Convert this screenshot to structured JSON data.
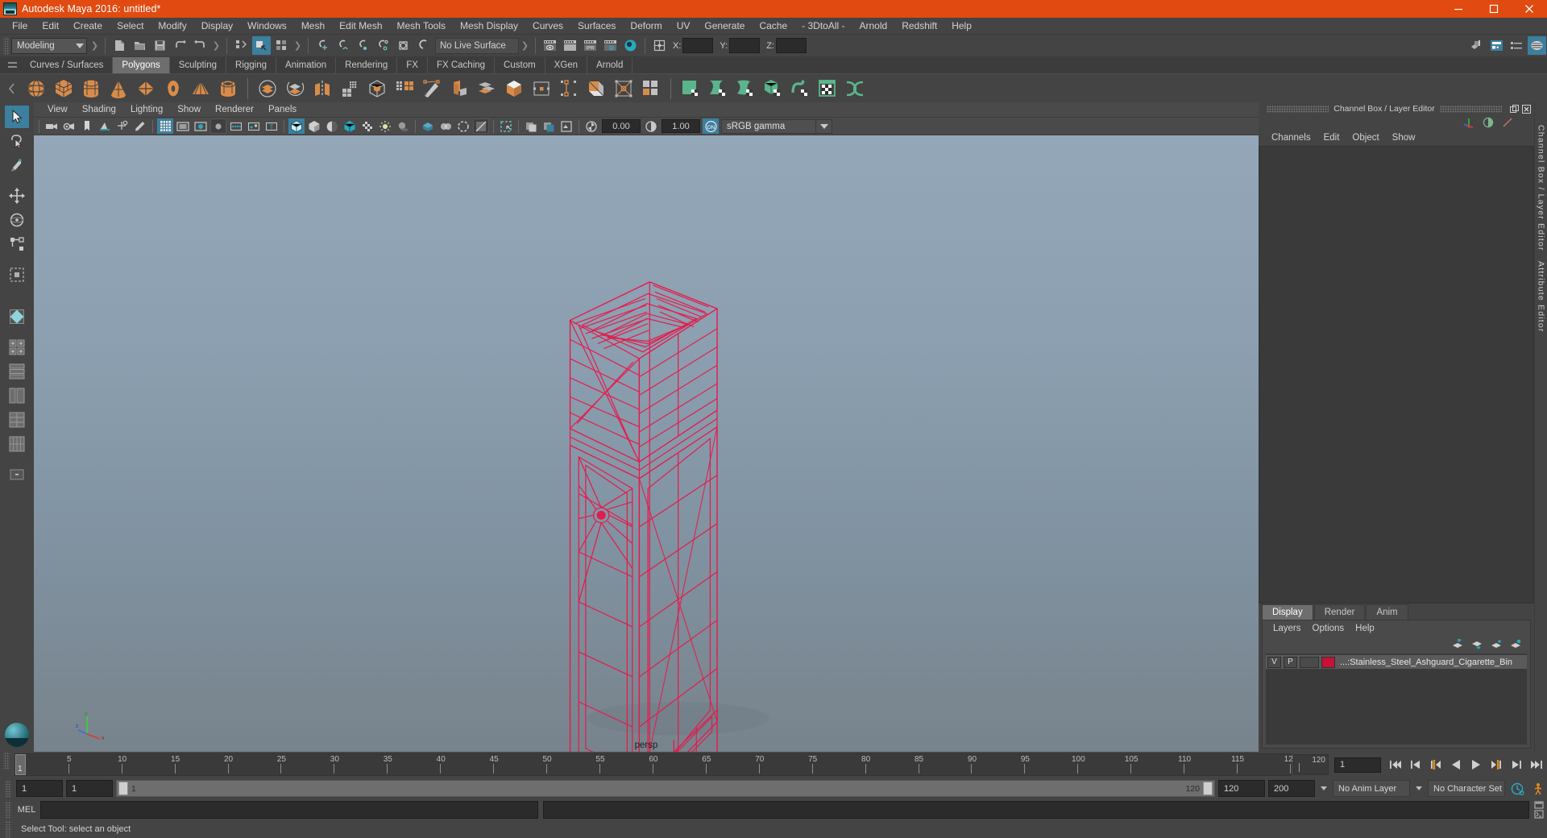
{
  "window": {
    "title": "Autodesk Maya 2016: untitled*",
    "logo_icon": "maya-logo-icon",
    "controls": [
      {
        "name": "minimize-button",
        "icon": "minimize-icon",
        "label": "–"
      },
      {
        "name": "maximize-button",
        "icon": "maximize-icon",
        "label": "❐"
      },
      {
        "name": "close-button",
        "icon": "close-icon",
        "label": "✕"
      }
    ],
    "titlebar_color": "#e14a10"
  },
  "menubar": {
    "items": [
      "File",
      "Edit",
      "Create",
      "Select",
      "Modify",
      "Display",
      "Windows",
      "Mesh",
      "Edit Mesh",
      "Mesh Tools",
      "Mesh Display",
      "Curves",
      "Surfaces",
      "Deform",
      "UV",
      "Generate",
      "Cache",
      "- 3DtoAll -",
      "Arnold",
      "Redshift",
      "Help"
    ]
  },
  "statusline": {
    "mode_menu": {
      "value": "Modeling",
      "name": "menu-set-dropdown"
    },
    "file_buttons": [
      {
        "name": "new-scene-button",
        "icon": "new-file-icon"
      },
      {
        "name": "open-scene-button",
        "icon": "open-folder-icon"
      },
      {
        "name": "save-scene-button",
        "icon": "save-disk-icon"
      },
      {
        "name": "undo-button",
        "icon": "undo-arrow-icon"
      },
      {
        "name": "redo-button",
        "icon": "redo-arrow-icon"
      }
    ],
    "selection_mode_buttons": [
      {
        "name": "select-by-hierarchy-button",
        "icon": "hierarchy-select-icon",
        "active": false
      },
      {
        "name": "select-by-object-type-button",
        "icon": "object-select-icon",
        "active": true
      },
      {
        "name": "select-by-component-type-button",
        "icon": "component-select-icon",
        "active": false
      }
    ],
    "snap_buttons": [
      {
        "name": "snap-to-grid-button",
        "icon": "snap-grid-icon"
      },
      {
        "name": "snap-to-curve-button",
        "icon": "snap-curve-icon"
      },
      {
        "name": "snap-to-point-button",
        "icon": "snap-point-icon"
      },
      {
        "name": "snap-to-projected-center-button",
        "icon": "snap-center-icon"
      },
      {
        "name": "snap-to-view-plane-button",
        "icon": "snap-viewplane-icon"
      },
      {
        "name": "make-live-button",
        "icon": "make-live-icon"
      }
    ],
    "live_surface": {
      "value": "No Live Surface",
      "name": "live-surface-field"
    },
    "render_buttons": [
      {
        "name": "render-current-frame-button",
        "icon": "render-eye-icon"
      },
      {
        "name": "redo-render-button",
        "icon": "render-blank-icon"
      },
      {
        "name": "ipr-render-button",
        "icon": "ipr-icon",
        "label": "IPR"
      },
      {
        "name": "render-settings-button",
        "icon": "render-gear-icon"
      },
      {
        "name": "hypershade-button",
        "icon": "hypershade-sphere-icon"
      }
    ],
    "transform_icon": {
      "name": "input-transform-icon",
      "icon": "transform-grid-icon"
    },
    "coords": [
      {
        "label": "X:",
        "value": "",
        "name": "coord-x-field"
      },
      {
        "label": "Y:",
        "value": "",
        "name": "coord-y-field"
      },
      {
        "label": "Z:",
        "value": "",
        "name": "coord-z-field"
      }
    ],
    "right_buttons": [
      {
        "name": "show-hide-modeling-toolkit-button",
        "icon": "modeling-toolkit-icon"
      },
      {
        "name": "show-hide-attribute-editor-button",
        "icon": "attribute-editor-icon"
      },
      {
        "name": "show-hide-tool-settings-button",
        "icon": "tool-settings-icon"
      },
      {
        "name": "show-hide-channel-box-button",
        "icon": "channel-box-icon",
        "active": true
      }
    ]
  },
  "shelf": {
    "tabs": [
      "Curves / Surfaces",
      "Polygons",
      "Sculpting",
      "Rigging",
      "Animation",
      "Rendering",
      "FX",
      "FX Caching",
      "Custom",
      "XGen",
      "Arnold"
    ],
    "active_tab": "Polygons",
    "icons": [
      {
        "name": "poly-sphere-button",
        "icon": "poly-sphere-icon",
        "color": "#d98c4a"
      },
      {
        "name": "poly-cube-button",
        "icon": "poly-cube-icon",
        "color": "#d98c4a"
      },
      {
        "name": "poly-cylinder-button",
        "icon": "poly-cylinder-icon",
        "color": "#d98c4a"
      },
      {
        "name": "poly-cone-button",
        "icon": "poly-cone-icon",
        "color": "#d98c4a"
      },
      {
        "name": "poly-plane-button",
        "icon": "poly-plane-icon",
        "color": "#d98c4a"
      },
      {
        "name": "poly-torus-button",
        "icon": "poly-torus-icon",
        "color": "#d98c4a"
      },
      {
        "name": "poly-pyramid-button",
        "icon": "poly-pyramid-icon",
        "color": "#d98c4a"
      },
      {
        "name": "poly-pipe-button",
        "icon": "poly-pipe-icon",
        "color": "#d98c4a"
      },
      {
        "separator": true
      },
      {
        "name": "combine-button",
        "icon": "combine-icon",
        "color": "#d98c4a"
      },
      {
        "name": "separate-button",
        "icon": "separate-icon",
        "color": "#d98c4a"
      },
      {
        "name": "mirror-geometry-button",
        "icon": "mirror-geometry-icon",
        "color": "#d98c4a"
      },
      {
        "name": "smooth-button",
        "icon": "smooth-grid-icon",
        "color": "#bdbdbd"
      },
      {
        "name": "boolean-button",
        "icon": "boolean-cube-icon",
        "color": "#bdbdbd"
      },
      {
        "name": "reduce-button",
        "icon": "reduce-icon",
        "color": "#d98c4a"
      },
      {
        "name": "create-polygon-tool-button",
        "icon": "create-poly-pen-icon",
        "color": "#d98c4a"
      },
      {
        "name": "extrude-button",
        "icon": "extrude-icon",
        "color": "#d98c4a"
      },
      {
        "name": "bevel-button",
        "icon": "bevel-icon",
        "color": "#d98c4a"
      },
      {
        "name": "bridge-button",
        "icon": "bridge-cube-icon",
        "color": "#d98c4a"
      },
      {
        "name": "merge-button",
        "icon": "merge-vertex-icon",
        "color": "#d98c4a"
      },
      {
        "name": "append-polygon-button",
        "icon": "append-poly-icon",
        "color": "#d98c4a"
      },
      {
        "name": "poke-face-button",
        "icon": "poke-face-icon",
        "color": "#d98c4a"
      },
      {
        "name": "wedge-button",
        "icon": "wedge-icon",
        "color": "#d98c4a"
      },
      {
        "name": "multi-cut-button",
        "icon": "multi-cut-icon",
        "color": "#d98c4a"
      },
      {
        "separator": true
      },
      {
        "name": "uv-planar-button",
        "icon": "uv-planar-icon",
        "color": "#5ab58c"
      },
      {
        "name": "uv-cylindrical-button",
        "icon": "uv-cylindrical-icon",
        "color": "#5ab58c"
      },
      {
        "name": "uv-spherical-button",
        "icon": "uv-spherical-icon",
        "color": "#5ab58c"
      },
      {
        "name": "uv-automatic-button",
        "icon": "uv-automatic-icon",
        "color": "#5ab58c"
      },
      {
        "name": "uv-unfold-button",
        "icon": "uv-unfold-icon",
        "color": "#5ab58c"
      },
      {
        "name": "uv-editor-button",
        "icon": "uv-editor-icon",
        "color": "#5ab58c"
      },
      {
        "name": "uv-layout-button",
        "icon": "uv-layout-icon",
        "color": "#5ab58c"
      }
    ]
  },
  "toolbox": {
    "tools": [
      {
        "name": "select-tool-button",
        "icon": "arrow-select-icon",
        "active": true
      },
      {
        "name": "lasso-select-tool-button",
        "icon": "lasso-select-icon",
        "active": false
      },
      {
        "name": "paint-select-tool-button",
        "icon": "paint-brush-icon",
        "active": false
      },
      {
        "name": "move-tool-button",
        "icon": "move-arrows-icon",
        "active": false
      },
      {
        "name": "rotate-tool-button",
        "icon": "rotate-circle-icon",
        "active": false
      },
      {
        "name": "scale-tool-button",
        "icon": "scale-box-icon",
        "active": false
      },
      {
        "name": "last-tool-button",
        "icon": "last-tool-icon",
        "active": false
      }
    ],
    "layout_presets": [
      {
        "name": "single-pane-layout-button",
        "icon": "single-pane-icon"
      },
      {
        "name": "two-pane-layout-button",
        "icon": "two-pane-icon"
      },
      {
        "name": "four-pane-layout-button",
        "icon": "four-pane-icon"
      },
      {
        "name": "persp-outliner-layout-button",
        "icon": "persp-outliner-icon"
      },
      {
        "name": "hypershade-layout-button",
        "icon": "hypershade-layout-icon"
      },
      {
        "name": "graph-editor-layout-button",
        "icon": "graph-editor-layout-icon"
      },
      {
        "name": "more-layouts-button",
        "icon": "more-layouts-icon",
        "label": "-"
      }
    ],
    "logo": {
      "name": "maya-logo-badge",
      "icon": "maya-sphere-icon"
    }
  },
  "viewport": {
    "menus": [
      "View",
      "Shading",
      "Lighting",
      "Show",
      "Renderer",
      "Panels"
    ],
    "tools": [
      {
        "name": "select-camera-button",
        "icon": "camera-icon"
      },
      {
        "name": "camera-attributes-button",
        "icon": "camera-attributes-icon"
      },
      {
        "name": "bookmark-button",
        "icon": "bookmark-icon"
      },
      {
        "name": "image-plane-button",
        "icon": "image-plane-icon"
      },
      {
        "name": "two-d-pan-zoom-button",
        "icon": "pan-zoom-icon"
      },
      {
        "name": "grease-pencil-button",
        "icon": "grease-pencil-icon"
      },
      {
        "name": "grid-toggle-button",
        "icon": "grid-icon",
        "active": true
      },
      {
        "name": "film-gate-button",
        "icon": "film-gate-icon"
      },
      {
        "name": "resolution-gate-button",
        "icon": "resolution-gate-icon"
      },
      {
        "name": "gate-mask-button",
        "icon": "gate-mask-icon",
        "active": false
      },
      {
        "name": "exposure-button",
        "icon": "exposure-icon"
      },
      {
        "name": "xray-joints-button",
        "icon": "xray-joints-icon"
      },
      {
        "name": "text-overlay-button",
        "icon": "text-overlay-icon"
      },
      {
        "name": "wireframe-shaded-button",
        "icon": "wireframe-cube-icon",
        "active": true
      },
      {
        "name": "smooth-shade-button",
        "icon": "smooth-shade-icon"
      },
      {
        "name": "shade-options-button",
        "icon": "shade-options-icon"
      },
      {
        "name": "textured-button",
        "icon": "textured-cube-icon"
      },
      {
        "name": "use-default-lighting-button",
        "icon": "checker-light-icon"
      },
      {
        "name": "use-all-lights-button",
        "icon": "bulb-icon"
      },
      {
        "name": "shadows-button",
        "icon": "shadow-icon"
      },
      {
        "name": "screen-space-ao-button",
        "icon": "ao-icon"
      },
      {
        "name": "motion-blur-button",
        "icon": "motion-blur-icon"
      },
      {
        "name": "multisample-aa-button",
        "icon": "aa-icon"
      },
      {
        "name": "isolate-select-button",
        "icon": "isolate-select-icon"
      },
      {
        "name": "xray-mode-button",
        "icon": "xray-mode-icon"
      },
      {
        "name": "xray-active-components-button",
        "icon": "xray-components-icon"
      },
      {
        "name": "exposure-gamma-toggle-button",
        "icon": "exposure-toggle-icon"
      }
    ],
    "exposure_value": "0.00",
    "gamma_value": "1.00",
    "view_transform": {
      "value": "sRGB gamma",
      "name": "view-transform-dropdown"
    },
    "camera_label": "persp",
    "axis_gizmo": {
      "name": "axis-gizmo",
      "x_label": "x",
      "y_label": "y",
      "z_label": "z"
    },
    "model": {
      "name": "wireframe-model",
      "description": "Stainless steel ashguard cigarette bin wireframe",
      "wire_color": "#e8174a"
    },
    "background_top": "#93a7b8",
    "background_bottom": "#78838c"
  },
  "channel_box": {
    "panel_title": "Channel Box / Layer Editor",
    "window_buttons": [
      {
        "name": "undock-panel-button",
        "icon": "undock-icon"
      },
      {
        "name": "close-panel-button",
        "icon": "close-icon"
      }
    ],
    "top_icons": [
      {
        "name": "show-manipulators-button",
        "icon": "manipulator-axis-icon"
      },
      {
        "name": "toggle-channel-box-button",
        "icon": "half-circle-icon"
      },
      {
        "name": "toggle-attribute-editor-button",
        "icon": "diagonal-line-icon"
      }
    ],
    "menus": [
      "Channels",
      "Edit",
      "Object",
      "Show"
    ],
    "content": ""
  },
  "layer_editor": {
    "tabs": [
      "Display",
      "Render",
      "Anim"
    ],
    "active_tab": "Display",
    "menus": [
      "Layers",
      "Options",
      "Help"
    ],
    "buttons": [
      {
        "name": "move-layer-up-button",
        "icon": "layer-up-icon"
      },
      {
        "name": "move-layer-down-button",
        "icon": "layer-down-icon"
      },
      {
        "name": "new-layer-button",
        "icon": "layer-new-icon"
      },
      {
        "name": "new-layer-from-selected-button",
        "icon": "layer-from-selected-icon"
      }
    ],
    "layers": [
      {
        "name": "layer-row",
        "visibility": "V",
        "playback": "P",
        "shading": "",
        "color": "#c51236",
        "label": "...:Stainless_Steel_Ashguard_Cigarette_Bin"
      }
    ]
  },
  "dock_tabs": [
    {
      "name": "dock-tab-channel-box",
      "label": "Channel Box / Layer Editor"
    },
    {
      "name": "dock-tab-attribute-editor",
      "label": "Attribute Editor"
    }
  ],
  "time_slider": {
    "start_tick": 1,
    "end_tick": 120,
    "tick_step": 5,
    "labeled_ticks": [
      5,
      10,
      15,
      20,
      25,
      30,
      35,
      40,
      45,
      50,
      55,
      60,
      65,
      70,
      75,
      80,
      85,
      90,
      95,
      100,
      105,
      110,
      115,
      120
    ],
    "current_frame_marker": "1",
    "end_label": "120",
    "current_frame_field": "1",
    "playback_buttons": [
      {
        "name": "go-to-start-button",
        "icon": "skip-start-icon"
      },
      {
        "name": "step-back-keyframe-button",
        "icon": "prev-key-icon"
      },
      {
        "name": "step-back-frame-button",
        "icon": "prev-frame-icon"
      },
      {
        "name": "play-backwards-button",
        "icon": "play-backward-icon"
      },
      {
        "name": "play-forwards-button",
        "icon": "play-forward-icon"
      },
      {
        "name": "step-forward-frame-button",
        "icon": "next-frame-icon"
      },
      {
        "name": "step-forward-keyframe-button",
        "icon": "next-key-icon"
      },
      {
        "name": "go-to-end-button",
        "icon": "skip-end-icon"
      }
    ]
  },
  "range_slider": {
    "anim_start": "1",
    "range_start": "1",
    "bar_start_label": "1",
    "bar_end_label": "120",
    "range_end": "120",
    "anim_end": "200",
    "anim_layer": {
      "value": "No Anim Layer",
      "name": "anim-layer-dropdown"
    },
    "character_set": {
      "value": "No Character Set",
      "name": "character-set-dropdown"
    },
    "right_buttons": [
      {
        "name": "auto-keyframe-button",
        "icon": "auto-key-icon"
      },
      {
        "name": "animation-preferences-button",
        "icon": "animation-prefs-icon"
      }
    ]
  },
  "command_line": {
    "language_label": "MEL",
    "input_value": "",
    "output_value": "",
    "buttons": [
      {
        "name": "script-editor-button",
        "icon": "script-editor-icon"
      }
    ]
  },
  "help_line": {
    "text": "Select Tool: select an object"
  }
}
